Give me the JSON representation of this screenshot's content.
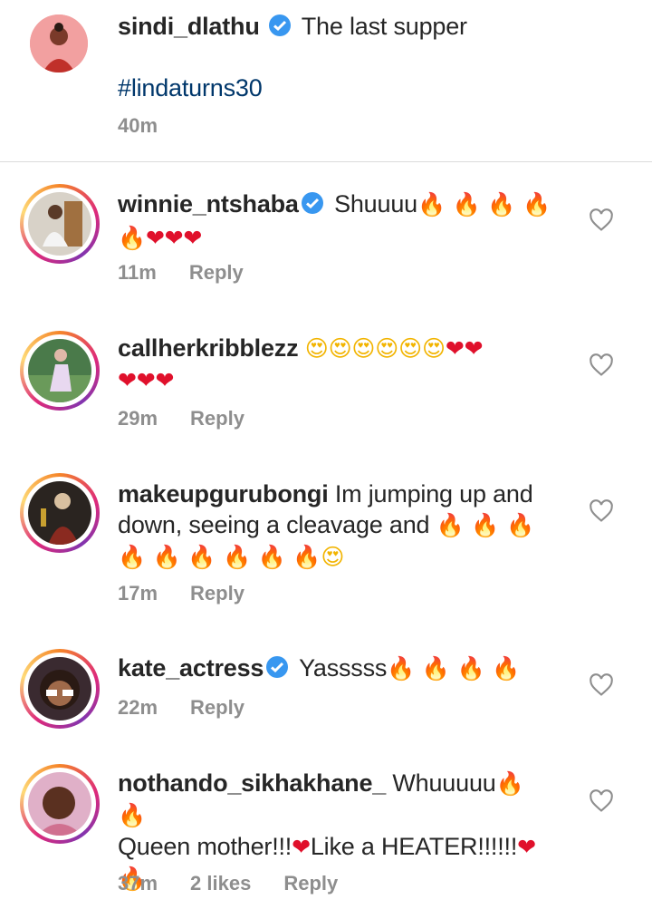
{
  "caption": {
    "username": "sindi_dlathu",
    "text": "The last supper",
    "hashtag": "#lindaturns30",
    "time": "40m"
  },
  "comments": [
    {
      "username": "winnie_ntshaba",
      "verified": true,
      "text_line1": "Shuuuu",
      "time": "11m",
      "reply": "Reply"
    },
    {
      "username": "callherkribblezz",
      "verified": false,
      "time": "29m",
      "reply": "Reply"
    },
    {
      "username": "makeupgurubongi",
      "verified": false,
      "text_line1": "Im jumping up and",
      "text_line2": "down, seeing a cleavage and",
      "time": "17m",
      "reply": "Reply"
    },
    {
      "username": "kate_actress",
      "verified": true,
      "text_line1": "Yasssss",
      "time": "22m",
      "reply": "Reply"
    },
    {
      "username": "nothando_sikhakhane_",
      "verified": false,
      "text_line1": "Whuuuuu",
      "text_line2": "Queen mother!!!",
      "text_line2b": "Like a HEATER!!!!!!",
      "time": "37m",
      "likes": "2 likes",
      "reply": "Reply"
    }
  ],
  "icons": {
    "like": "heart-outline-icon",
    "verified": "verified-badge-icon",
    "fire": "fire-emoji",
    "heart": "red-heart-emoji",
    "heart_eyes": "heart-eyes-emoji"
  },
  "colors": {
    "verified": "#3897f0",
    "meta": "#8e8e8e",
    "hashtag": "#00376b",
    "divider": "#dbdbdb"
  }
}
